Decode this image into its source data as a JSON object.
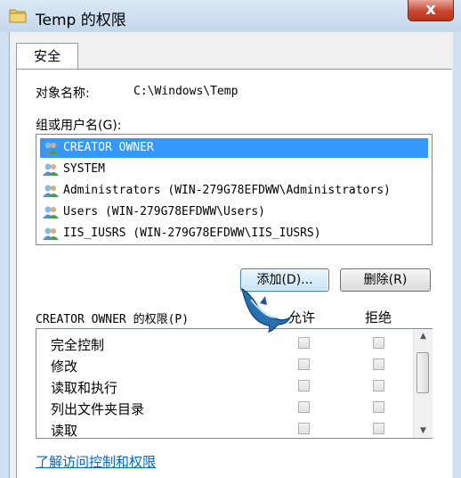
{
  "window": {
    "title": "Temp 的权限",
    "close_label": "x"
  },
  "tabs": [
    {
      "label": "安全"
    }
  ],
  "object": {
    "label": "对象名称:",
    "value": "C:\\Windows\\Temp"
  },
  "users": {
    "label": "组或用户名(G):",
    "items": [
      {
        "name": "CREATOR OWNER",
        "selected": true
      },
      {
        "name": "SYSTEM"
      },
      {
        "name": "Administrators (WIN-279G78EFDWW\\Administrators)"
      },
      {
        "name": "Users (WIN-279G78EFDWW\\Users)"
      },
      {
        "name": "IIS_IUSRS (WIN-279G78EFDWW\\IIS_IUSRS)"
      }
    ]
  },
  "buttons": {
    "add": "添加(D)...",
    "remove": "删除(R)"
  },
  "permissions": {
    "label": "CREATOR OWNER 的权限(P)",
    "allow_header": "允许",
    "deny_header": "拒绝",
    "items": [
      {
        "name": "完全控制"
      },
      {
        "name": "修改"
      },
      {
        "name": "读取和执行"
      },
      {
        "name": "列出文件夹目录"
      },
      {
        "name": "读取"
      }
    ]
  },
  "link": "了解访问控制和权限",
  "colors": {
    "selection": "#3399ff",
    "link": "#0066cc",
    "close": "#c9452f"
  }
}
